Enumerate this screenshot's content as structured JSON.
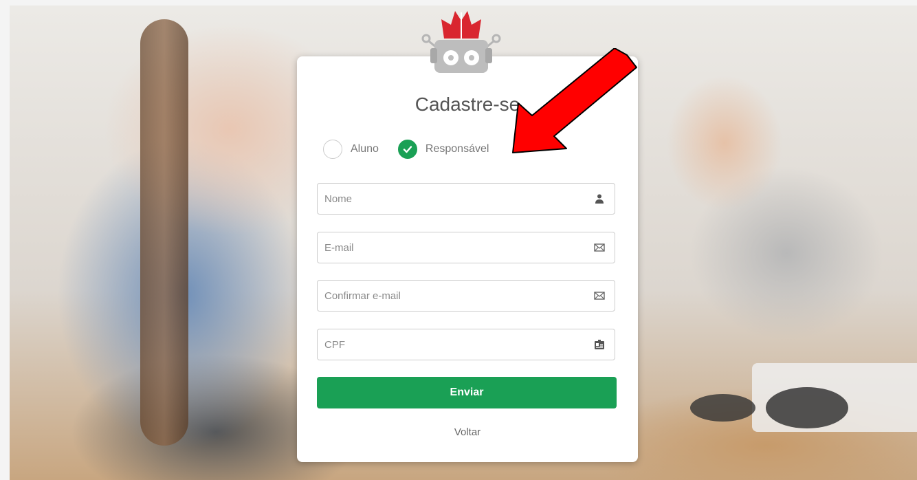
{
  "title": "Cadastre-se",
  "account_type": {
    "options": [
      {
        "label": "Aluno",
        "checked": false
      },
      {
        "label": "Responsável",
        "checked": true
      }
    ]
  },
  "form": {
    "name_placeholder": "Nome",
    "email_placeholder": "E-mail",
    "confirm_email_placeholder": "Confirmar e-mail",
    "cpf_placeholder": "CPF",
    "submit_label": "Enviar",
    "back_label": "Voltar"
  },
  "colors": {
    "accent": "#1aa055",
    "annotation_arrow": "#ff0000",
    "logo_red": "#d9262f",
    "logo_gray": "#b5b5b5"
  },
  "icons": {
    "name_field": "user-icon",
    "email_field": "envelope-icon",
    "confirm_email_field": "envelope-icon",
    "cpf_field": "id-card-icon"
  }
}
